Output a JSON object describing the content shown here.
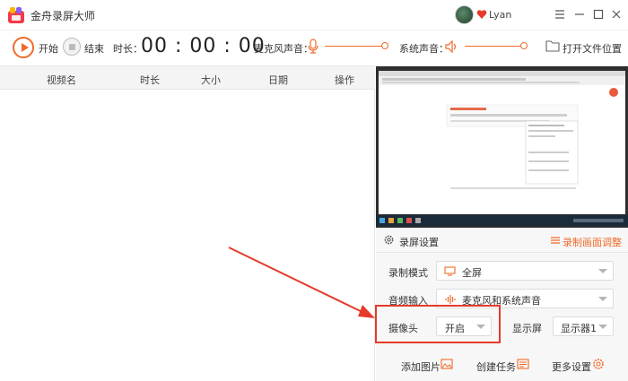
{
  "app": {
    "title": "金舟录屏大师"
  },
  "user": {
    "name": "Lyan"
  },
  "controls": {
    "start_label": "开始",
    "end_label": "结束",
    "duration_label": "时长：",
    "timer": "00 : 00 : 00",
    "mic_label": "麦克风声音：",
    "system_label": "系统声音：",
    "open_folder_label": "打开文件位置"
  },
  "table": {
    "columns": [
      "视频名",
      "时长",
      "大小",
      "日期",
      "操作"
    ]
  },
  "settings": {
    "title": "录屏设置",
    "adjust_label": "录制画面调整",
    "record_mode_label": "录制模式",
    "record_mode_value": "全屏",
    "audio_label": "音频输入",
    "audio_value": "麦克风和系统声音",
    "camera_label": "摄像头",
    "camera_value": "开启",
    "display_label": "显示屏",
    "display_value": "显示器1",
    "add_image_label": "添加图片",
    "create_task_label": "创建任务",
    "more_settings_label": "更多设置"
  },
  "colors": {
    "accent": "#f06a2a",
    "annotation_red": "#e53b2a"
  }
}
